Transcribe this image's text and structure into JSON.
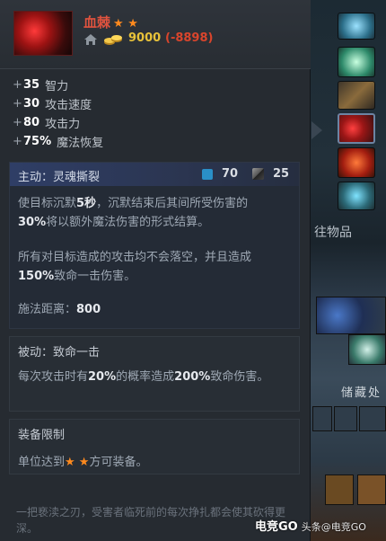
{
  "item": {
    "name": "血棘",
    "stars": "★ ★",
    "price": "9000",
    "price_diff": "(-8898)",
    "icon": "bloodthorn-icon"
  },
  "stats": [
    {
      "plus": "+",
      "value": "35",
      "label": "智力"
    },
    {
      "plus": "+",
      "value": "30",
      "label": "攻击速度"
    },
    {
      "plus": "+",
      "value": "80",
      "label": "攻击力"
    },
    {
      "plus": "+",
      "value": "75%",
      "label": "魔法恢复"
    }
  ],
  "active": {
    "title": "主动：灵魂撕裂",
    "mana_cost": "70",
    "cooldown": "25",
    "desc1_a": "使目标沉默",
    "desc1_b": "5秒",
    "desc1_c": "，沉默结束后其间所受伤害的",
    "desc1_d": "30%",
    "desc1_e": "将以额外魔法伤害的形式结算。",
    "desc2_a": "所有对目标造成的攻击均不会落空，并且造成",
    "desc2_b": "150%",
    "desc2_c": "致命一击伤害。",
    "range_label": "施法距离：",
    "range_value": "800"
  },
  "passive": {
    "title": "被动：致命一击",
    "desc_a": "每次攻击时有",
    "desc_b": "20%",
    "desc_c": "的概率造成",
    "desc_d": "200%",
    "desc_e": "致命伤害。"
  },
  "requirement": {
    "title": "装备限制",
    "text_a": "单位达到",
    "stars": "★ ★",
    "text_b": "方可装备。"
  },
  "lore": "一把亵渎之刃，受害者临死前的每次挣扎都会使其砍得更深。",
  "scene": {
    "label": "往物品",
    "stash_label": "储藏处"
  },
  "watermark": {
    "main": "电竞GO",
    "sub": "头条@电竞GO"
  },
  "colors": {
    "item_name": "#e0533f",
    "star": "#ff8a1e",
    "gold": "#e8c23a",
    "mana": "#2a8fc7"
  }
}
